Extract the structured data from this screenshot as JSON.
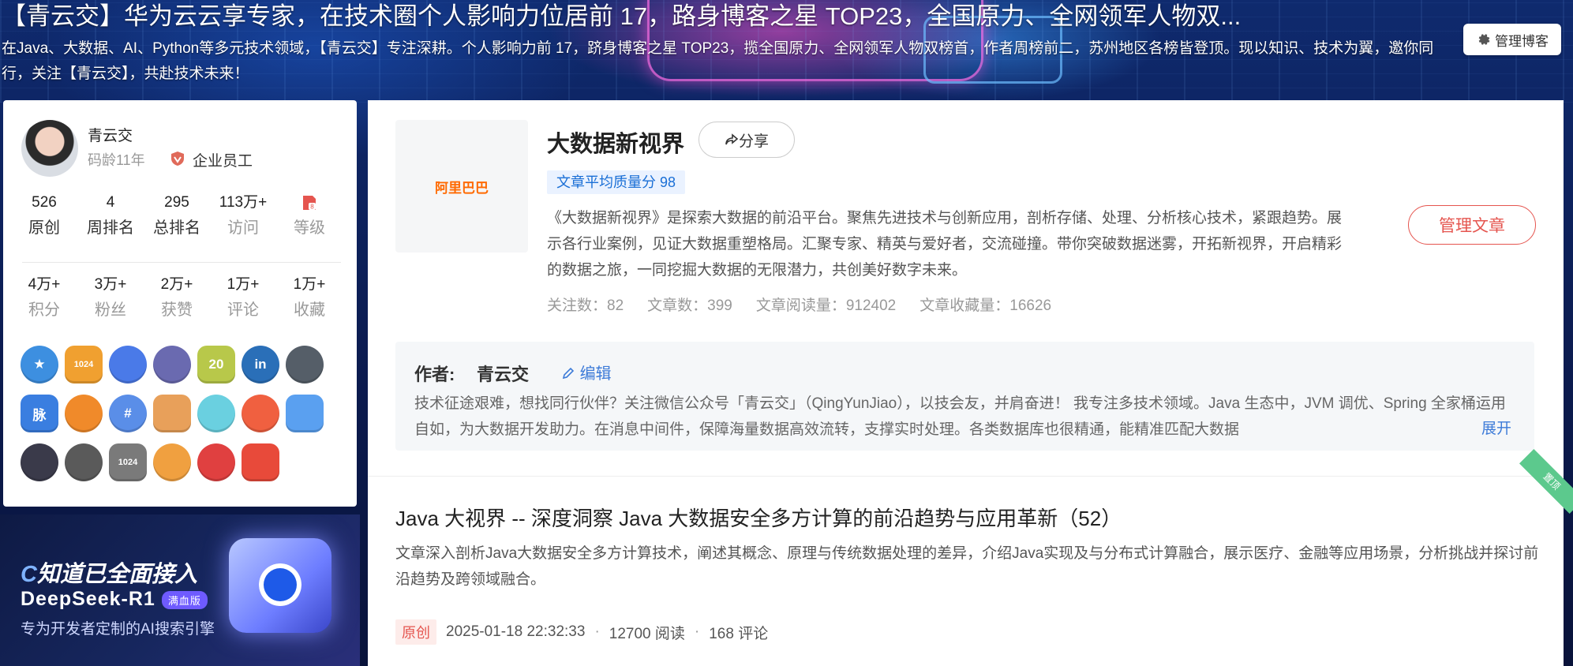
{
  "header": {
    "title": "【青云交】华为云云享专家，在技术圈个人影响力位居前 17，路身博客之星 TOP23，全国原力、全网领军人物双...",
    "description": "在Java、大数据、AI、Python等多元技术领域，【青云交】专注深耕。个人影响力前 17，跻身博客之星 TOP23，揽全国原力、全网领军人物双榜首，作者周榜前二，苏州地区各榜皆登顶。现以知识、技术为翼，邀你同行，关注【青云交】，共赴技术未来！",
    "manage_label": "管理博客"
  },
  "profile": {
    "name": "青云交",
    "years": "码龄11年",
    "company": "企业员工",
    "stats_row1": [
      {
        "value": "526",
        "label": "原创"
      },
      {
        "value": "4",
        "label": "周排名"
      },
      {
        "value": "295",
        "label": "总排名"
      },
      {
        "value": "113万+",
        "label": "访问"
      },
      {
        "value": "",
        "label": "等级"
      }
    ],
    "stats_row2": [
      {
        "value": "4万+",
        "label": "积分"
      },
      {
        "value": "3万+",
        "label": "粉丝"
      },
      {
        "value": "2万+",
        "label": "获赞"
      },
      {
        "value": "1万+",
        "label": "评论"
      },
      {
        "value": "1万+",
        "label": "收藏"
      }
    ],
    "badges": [
      {
        "icon": "star-badge-icon",
        "text": "★",
        "color": "#3d8fe0"
      },
      {
        "icon": "1024-badge-icon",
        "text": "1024",
        "color": "#f0a030"
      },
      {
        "icon": "planet-badge-icon",
        "text": "",
        "color": "#4a7ae8"
      },
      {
        "icon": "rank-badge-icon",
        "text": "",
        "color": "#6a6ab0"
      },
      {
        "icon": "20-badge-icon",
        "text": "20",
        "color": "#b8c84a"
      },
      {
        "icon": "linkedin-badge-icon",
        "text": "in",
        "color": "#2a6fb8"
      },
      {
        "icon": "github-badge-icon",
        "text": "",
        "color": "#555e68"
      },
      {
        "icon": "network-badge-icon",
        "text": "脉",
        "color": "#3a7ee0"
      },
      {
        "icon": "medal-badge-icon",
        "text": "",
        "color": "#f08a2a"
      },
      {
        "icon": "hash-badge-icon",
        "text": "#",
        "color": "#5a8ee8"
      },
      {
        "icon": "monkey-badge-icon",
        "text": "",
        "color": "#e8a05a"
      },
      {
        "icon": "chat-badge-icon",
        "text": "",
        "color": "#6ad0e0"
      },
      {
        "icon": "bulb-badge-icon",
        "text": "",
        "color": "#f06040"
      },
      {
        "icon": "pen-badge-icon",
        "text": "",
        "color": "#5aa0f0"
      },
      {
        "icon": "astronaut-badge-icon",
        "text": "",
        "color": "#3a3a4a"
      },
      {
        "icon": "bracket-badge-icon",
        "text": "",
        "color": "#5a5a5a"
      },
      {
        "icon": "1024b-badge-icon",
        "text": "1024",
        "color": "#7a7a7a"
      },
      {
        "icon": "book-badge-icon",
        "text": "",
        "color": "#f0a040"
      },
      {
        "icon": "nib-badge-icon",
        "text": "",
        "color": "#e04040"
      },
      {
        "icon": "monkey2-badge-icon",
        "text": "",
        "color": "#e84a3a"
      }
    ]
  },
  "ad": {
    "line1a": "C",
    "line1b": "知道已全面接入",
    "line2": "DeepSeek-R1",
    "tag": "满血版",
    "line3": "专为开发者定制的AI搜索引擎"
  },
  "column": {
    "logo_text": "阿里巴巴",
    "name": "大数据新视界",
    "share_label": "分享",
    "quality": "文章平均质量分 98",
    "description": "《大数据新视界》是探索大数据的前沿平台。聚焦先进技术与创新应用，剖析存储、处理、分析核心技术，紧跟趋势。展示各行业案例，见证大数据重塑格局。汇聚专家、精英与爱好者，交流碰撞。带你突破数据迷雾，开拓新视界，开启精彩的数据之旅，一同挖掘大数据的无限潜力，共创美好数字未来。",
    "stats": [
      "关注数：82",
      "文章数：399",
      "文章阅读量：912402",
      "文章收藏量：16626"
    ],
    "manage_label": "管理文章"
  },
  "author": {
    "label": "作者:",
    "name": "青云交",
    "edit_label": "编辑",
    "bio": "技术征途艰难，想找同行伙伴？关注微信公众号「青云交」（QingYunJiao），以技会友，并肩奋进！ 我专注多技术领域。Java 生态中，JVM 调优、Spring 全家桶运用自如，为大数据开发助力。在消息中间件，保障海量数据高效流转，支撑实时处理。各类数据库也很精通，能精准匹配大数据",
    "expand_label": "展开"
  },
  "article": {
    "pin_label": "置顶",
    "title": "Java 大视界 -- 深度洞察 Java 大数据安全多方计算的前沿趋势与应用革新（52）",
    "desc": "文章深入剖析Java大数据安全多方计算技术，阐述其概念、原理与传统数据处理的差异，介绍Java实现及与分布式计算融合，展示医疗、金融等应用场景，分析挑战并探讨前沿趋势及跨领域融合。",
    "type": "原创",
    "date": "2025-01-18 22:32:33",
    "reads": "12700 阅读",
    "comments": "168 评论"
  }
}
